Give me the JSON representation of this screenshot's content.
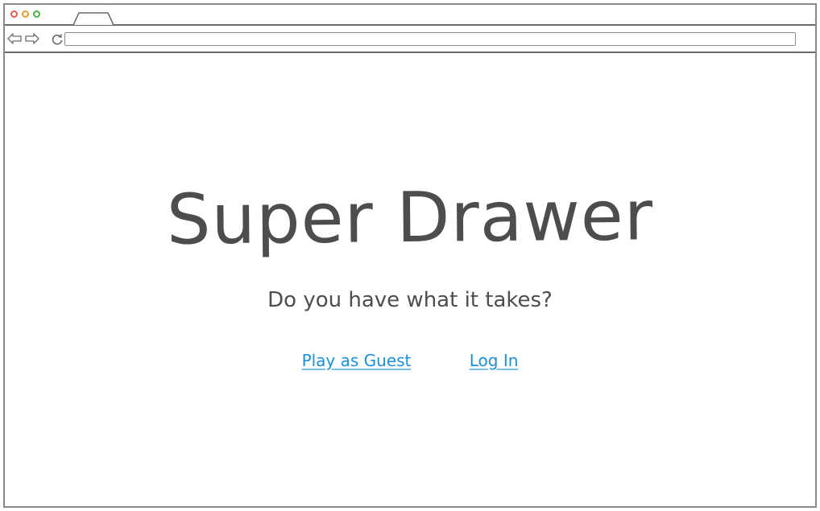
{
  "page": {
    "title": "Super Drawer",
    "subtitle": "Do you have what it takes?"
  },
  "actions": {
    "guest_label": "Play as Guest",
    "login_label": "Log In"
  },
  "browser": {
    "url": "",
    "tab_title": ""
  },
  "colors": {
    "link": "#1f8ed8",
    "text": "#4d4d4d",
    "close_dot": "#e05a5a",
    "minimize_dot": "#e0a030",
    "maximize_dot": "#4ab04a"
  }
}
